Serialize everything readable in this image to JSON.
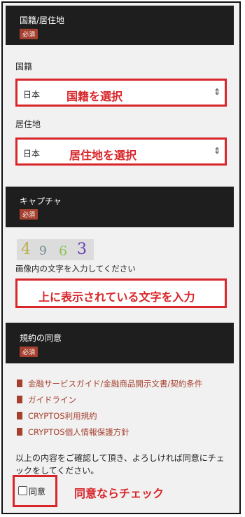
{
  "nationality_section": {
    "header": "国籍/居住地",
    "badge": "必須",
    "nationality_label": "国籍",
    "nationality_value": "日本",
    "nationality_annotation": "国籍を選択",
    "residence_label": "居住地",
    "residence_value": "日本",
    "residence_annotation": "居住地を選択"
  },
  "captcha_section": {
    "header": "キャプチャ",
    "badge": "必須",
    "captcha_chars": [
      "4",
      "9",
      "6",
      "3"
    ],
    "instruction": "画像内の文字を入力してください",
    "input_annotation": "上に表示されている文字を入力"
  },
  "terms_section": {
    "header": "規約の同意",
    "badge": "必須",
    "links": [
      "金融サービスガイド/金融商品開示文書/契約条件",
      "ガイドライン",
      "CRYPTOS利用規約",
      "CRYPTOS個人情報保護方針"
    ],
    "confirm_text": "以上の内容をご確認して頂き、よろしければ同意にチェックをしてください。",
    "agree_label": "同意",
    "agree_annotation": "同意ならチェック"
  },
  "colors": {
    "accent": "#d8262a",
    "badge": "#a5402e",
    "header_bg": "#1e1e1e"
  }
}
